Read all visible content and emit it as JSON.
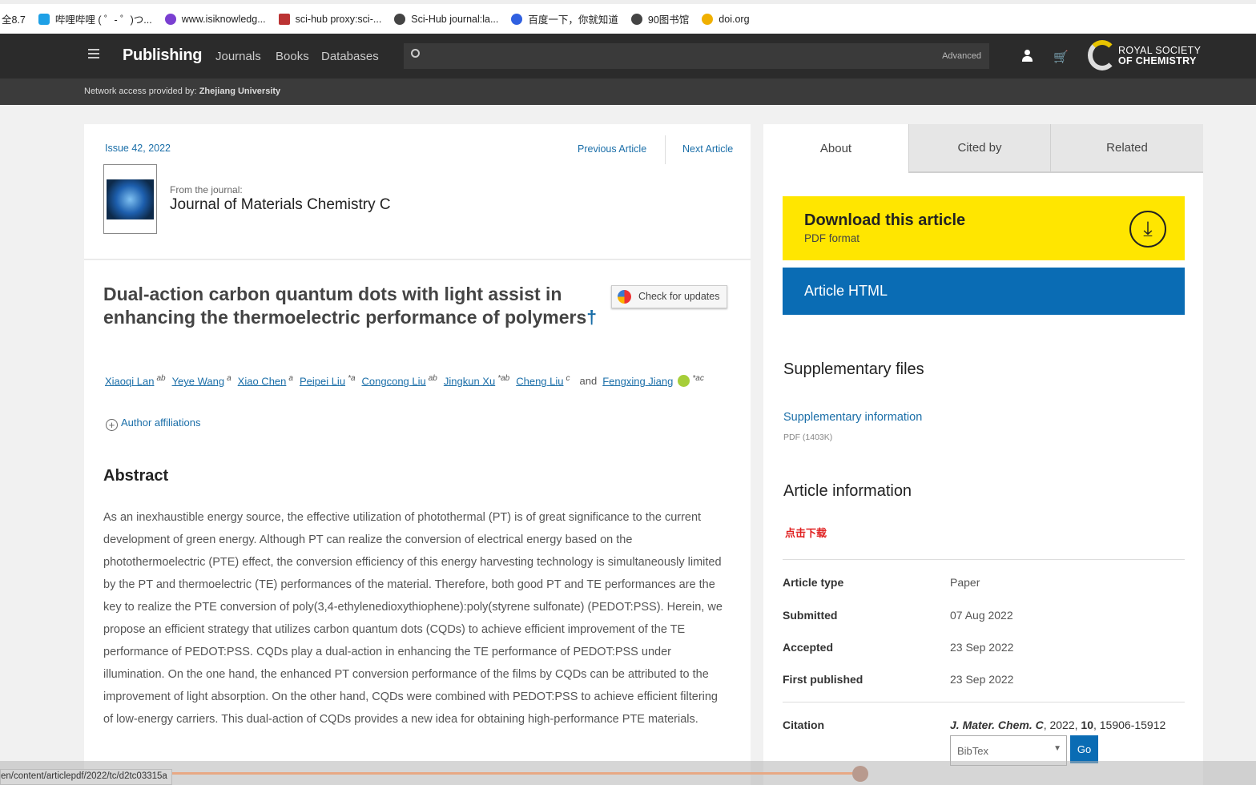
{
  "bookmarks": [
    "全8.7",
    "哔哩哔哩 ( ゜- ゜)つ...",
    "www.isiknowledg...",
    "sci-hub proxy:sci-...",
    "Sci-Hub journal:la...",
    "百度一下，你就知道",
    "90图书馆",
    "doi.org"
  ],
  "nav": {
    "brand": "Publishing",
    "links": [
      "Journals",
      "Books",
      "Databases"
    ],
    "search_advanced": "Advanced",
    "logo_line1": "ROYAL SOCIETY",
    "logo_line2": "OF CHEMISTRY"
  },
  "access": {
    "label": "Network access provided by:",
    "institution": "Zhejiang University"
  },
  "article": {
    "issue": "Issue 42, 2022",
    "prev": "Previous Article",
    "next": "Next Article",
    "from_journal": "From the journal:",
    "journal": "Journal of Materials Chemistry C",
    "title": "Dual-action carbon quantum dots with light assist in enhancing the thermoelectric performance of polymers",
    "dagger": "†",
    "check_updates": "Check for updates",
    "authors": [
      {
        "name": "Xiaoqi Lan",
        "sup": "ab"
      },
      {
        "name": "Yeye Wang",
        "sup": "a"
      },
      {
        "name": "Xiao Chen",
        "sup": "a"
      },
      {
        "name": "Peipei Liu",
        "sup": "*a"
      },
      {
        "name": "Congcong Liu",
        "sup": "ab"
      },
      {
        "name": "Jingkun Xu",
        "sup": "*ab"
      },
      {
        "name": "Cheng Liu",
        "sup": "c"
      },
      {
        "name": "Fengxing Jiang",
        "sup": "*ac"
      }
    ],
    "and": "and",
    "affiliations": "Author affiliations",
    "abstract_heading": "Abstract",
    "abstract": "As an inexhaustible energy source, the effective utilization of photothermal (PT) is of great significance to the current development of green energy. Although PT can realize the conversion of electrical energy based on the photothermoelectric (PTE) effect, the conversion efficiency of this energy harvesting technology is simultaneously limited by the PT and thermoelectric (TE) performances of the material. Therefore, both good PT and TE performances are the key to realize the PTE conversion of poly(3,4-ethylenedioxythiophene):poly(styrene sulfonate) (PEDOT:PSS). Herein, we propose an efficient strategy that utilizes carbon quantum dots (CQDs) to achieve efficient improvement of the TE performance of PEDOT:PSS. CQDs play a dual-action in enhancing the TE performance of PEDOT:PSS under illumination. On the one hand, the enhanced PT conversion performance of the films by CQDs can be attributed to the improvement of light absorption. On the other hand, CQDs were combined with PEDOT:PSS to achieve efficient filtering of low-energy carriers. This dual-action of CQDs provides a new idea for obtaining high-performance PTE materials."
  },
  "side": {
    "tabs": [
      "About",
      "Cited by",
      "Related"
    ],
    "download_title": "Download this article",
    "download_sub": "PDF format",
    "html_button": "Article HTML",
    "supp_heading": "Supplementary files",
    "supp_link": "Supplementary information",
    "supp_size": "PDF (1403K)",
    "info_heading": "Article information",
    "red_note": "点击下载",
    "rows": [
      {
        "k": "Article type",
        "v": "Paper"
      },
      {
        "k": "Submitted",
        "v": "07 Aug 2022"
      },
      {
        "k": "Accepted",
        "v": "23 Sep 2022"
      },
      {
        "k": "First published",
        "v": "23 Sep 2022"
      }
    ],
    "citation_label": "Citation",
    "citation_journal": "J. Mater. Chem. C",
    "citation_rest1": ", 2022, ",
    "citation_vol": "10",
    "citation_rest2": ", 15906-15912",
    "format": "BibTex",
    "go": "Go"
  },
  "status_url": "en/content/articlepdf/2022/tc/d2tc03315a",
  "colors": {
    "accent": "#1a6ea8",
    "download": "#ffe600",
    "html": "#0a6cb4",
    "nav": "#2b2b2b"
  }
}
